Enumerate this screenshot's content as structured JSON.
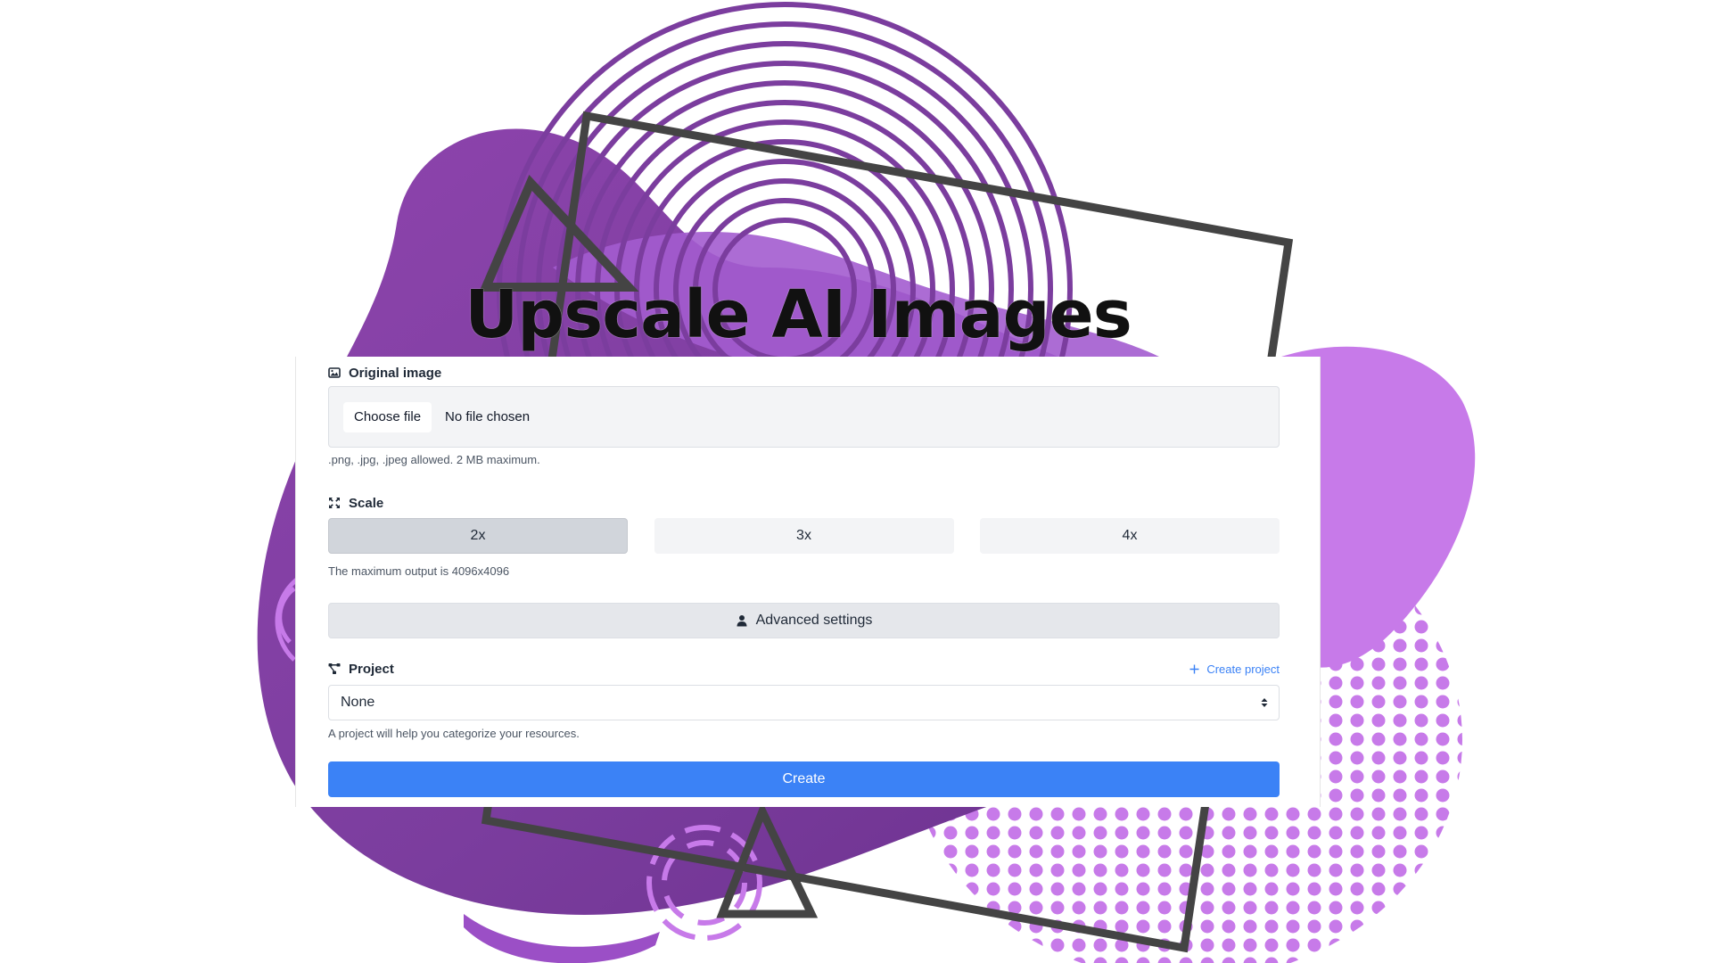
{
  "headline": "Upscale AI Images",
  "colors": {
    "accent_blue": "#3b82f6",
    "purple_dark": "#7b3d9e",
    "purple_light": "#c47ae8",
    "frame_gray": "#444444"
  },
  "original_image": {
    "label": "Original image",
    "icon": "image-icon",
    "choose_button": "Choose file",
    "status": "No file chosen",
    "help": ".png, .jpg, .jpeg allowed. 2 MB maximum."
  },
  "scale": {
    "label": "Scale",
    "icon": "expand-icon",
    "options": [
      "2x",
      "3x",
      "4x"
    ],
    "selected": "2x",
    "help": "The maximum output is 4096x4096"
  },
  "advanced": {
    "label": "Advanced settings",
    "icon": "user-icon"
  },
  "project": {
    "label": "Project",
    "icon": "share-nodes-icon",
    "create_link": "Create project",
    "create_icon": "plus-icon",
    "selected": "None",
    "help": "A project will help you categorize your resources."
  },
  "create_button": "Create"
}
